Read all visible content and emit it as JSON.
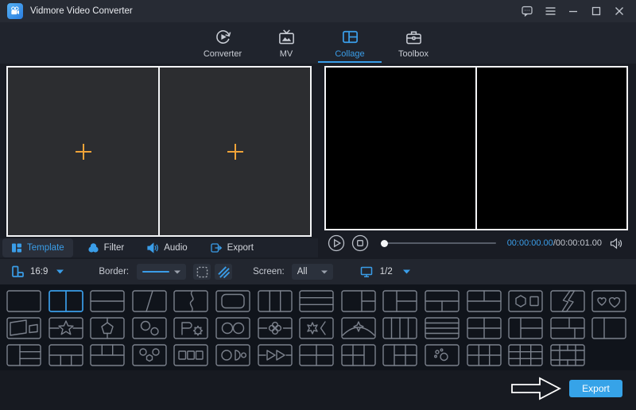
{
  "colors": {
    "accent": "#3a9de8",
    "plus_orange": "#f0a338",
    "export_button": "#36a3e8",
    "tile_border": "#7b818c",
    "panel_border": "#f3f4f6"
  },
  "titlebar": {
    "app_title": "Vidmore Video Converter",
    "window_controls": [
      "feedback",
      "menu",
      "minimize",
      "maximize",
      "close"
    ]
  },
  "nav": {
    "tabs": [
      {
        "id": "converter",
        "label": "Converter",
        "active": false
      },
      {
        "id": "mv",
        "label": "MV",
        "active": false
      },
      {
        "id": "collage",
        "label": "Collage",
        "active": true
      },
      {
        "id": "toolbox",
        "label": "Toolbox",
        "active": false
      }
    ]
  },
  "collage_editor": {
    "cell_count": 2,
    "placeholder_icon": "plus-icon"
  },
  "subtabs": [
    {
      "id": "template",
      "label": "Template",
      "active": true
    },
    {
      "id": "filter",
      "label": "Filter",
      "active": false
    },
    {
      "id": "audio",
      "label": "Audio",
      "active": false
    },
    {
      "id": "export",
      "label": "Export",
      "active": false
    }
  ],
  "player": {
    "time_current": "00:00:00.00",
    "time_separator": "/",
    "time_total": "00:00:01.00",
    "progress_percent": 0
  },
  "toolbar": {
    "aspect_ratio": "16:9",
    "border_label": "Border:",
    "screen_label": "Screen:",
    "screen_value": "All",
    "page_indicator": "1/2"
  },
  "templates": {
    "selected": {
      "row": 0,
      "index": 1
    },
    "rows": [
      [
        "single",
        "split-v2",
        "split-h2",
        "split-diagonal",
        "split-curve",
        "inset-rounded",
        "split-v3",
        "split-h3",
        "left1-right2-wide",
        "left1-right2",
        "top1-bottom2",
        "top2-bottom1",
        "hexagon-square",
        "lightning",
        "hearts"
      ],
      [
        "skew-panels",
        "star-center",
        "pentagon-center",
        "circles-diagonal",
        "flag-gear",
        "circles-pair",
        "clover-center",
        "burst-bracket",
        "arch-sparkle",
        "split-v4",
        "split-h4",
        "grid-2x2",
        "left1-right2-b",
        "top2-bottom-right",
        "split-v2-offset"
      ],
      [
        "left1-right3",
        "top1-bottom3",
        "top3-bottom1",
        "circles-hex-trio",
        "squares-trio",
        "circle-moon-dot",
        "triangles-pair",
        "grid-2x2-b",
        "grid-left-col-right",
        "left-col-grid-right",
        "bubbles",
        "grid-3x2",
        "grid-3x3",
        "frame-cells"
      ]
    ]
  },
  "export_bar": {
    "button_label": "Export"
  }
}
